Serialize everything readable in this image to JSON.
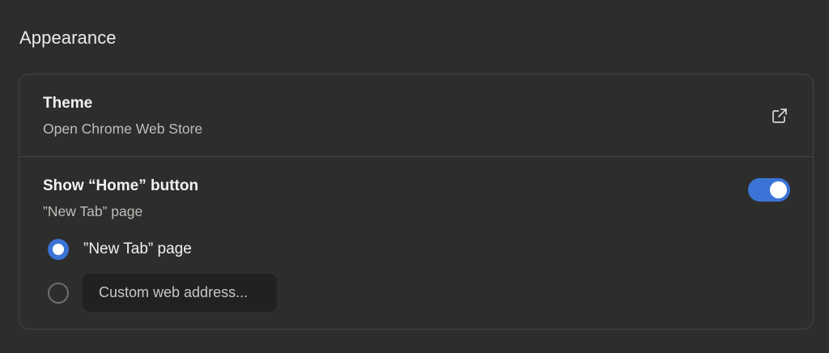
{
  "section": {
    "title": "Appearance"
  },
  "theme": {
    "title": "Theme",
    "subtitle": "Open Chrome Web Store",
    "icon": "external-link-icon"
  },
  "home_button": {
    "title": "Show “Home” button",
    "subtitle": "”New Tab” page",
    "toggle_on": true,
    "accent_color": "#3b74d6",
    "options": [
      {
        "label": "”New Tab” page",
        "selected": true
      },
      {
        "label": "Custom web address...",
        "selected": false
      }
    ],
    "custom_address": {
      "value": "",
      "placeholder": "Custom web address..."
    }
  }
}
